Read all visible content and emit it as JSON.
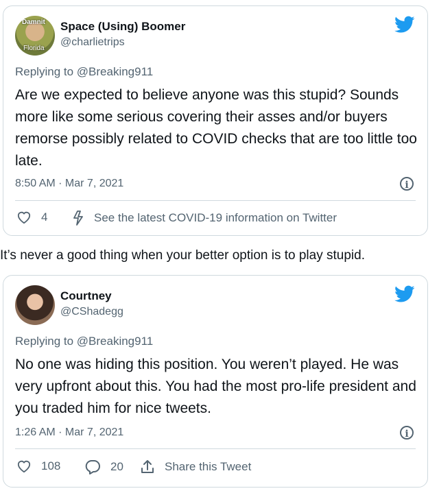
{
  "tweets": [
    {
      "display_name": "Space (Using) Boomer",
      "handle": "@charlietrips",
      "avatar_text_top": "Damnit",
      "avatar_text_bottom": "Florida",
      "replying_to": "Replying to @Breaking911",
      "body": "Are we expected to believe anyone was this stupid? Sounds more like some serious covering their asses and/or buyers remorse possibly related to COVID checks that are too little too late.",
      "timestamp": "8:50 AM · Mar 7, 2021",
      "like_count": "4",
      "covid_link": "See the latest COVID-19 information on Twitter"
    },
    {
      "display_name": "Courtney",
      "handle": "@CShadegg",
      "replying_to": "Replying to @Breaking911",
      "body": "No one was hiding this position. You weren’t played. He was very upfront about this. You had the most pro-life president and you traded him for nice tweets.",
      "timestamp": "1:26 AM · Mar 7, 2021",
      "like_count": "108",
      "reply_count": "20",
      "share_label": "Share this Tweet"
    }
  ],
  "between_text": "It’s never a good thing when your better option is to play stupid.",
  "colors": {
    "twitter_blue": "#1d9bf0",
    "muted": "#536471",
    "border": "#cfd9de"
  },
  "icons": [
    "twitter-bird-icon",
    "info-icon",
    "heart-icon",
    "bolt-icon",
    "reply-icon",
    "share-icon"
  ]
}
